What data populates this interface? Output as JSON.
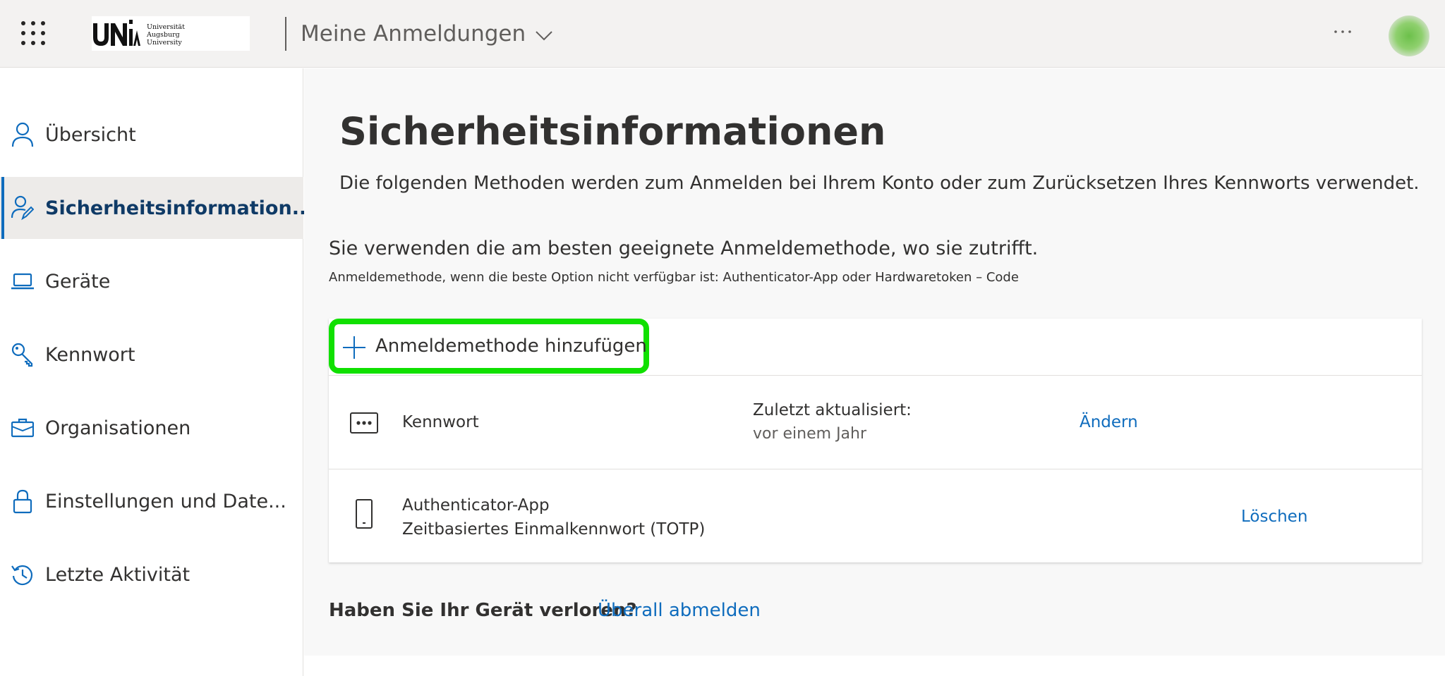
{
  "header": {
    "logo": {
      "mark": "UNiA",
      "lines": [
        "Universität",
        "Augsburg",
        "University"
      ]
    },
    "app_title": "Meine Anmeldungen",
    "more_label": "···"
  },
  "sidebar": {
    "items": [
      {
        "label": "Übersicht",
        "icon": "person-icon"
      },
      {
        "label": "Sicherheitsinformation...",
        "icon": "person-key-icon",
        "active": true
      },
      {
        "label": "Geräte",
        "icon": "laptop-icon"
      },
      {
        "label": "Kennwort",
        "icon": "key-icon"
      },
      {
        "label": "Organisationen",
        "icon": "briefcase-icon"
      },
      {
        "label": "Einstellungen und Date...",
        "icon": "lock-icon"
      },
      {
        "label": "Letzte Aktivität",
        "icon": "history-icon"
      }
    ]
  },
  "main": {
    "title": "Sicherheitsinformationen",
    "description": "Die folgenden Methoden werden zum Anmelden bei Ihrem Konto oder zum Zurücksetzen Ihres Kennworts verwendet.",
    "default_heading": "Sie verwenden die am besten geeignete Anmeldemethode, wo sie zutrifft.",
    "default_sub": "Anmeldemethode, wenn die beste Option nicht verfügbar ist: Authenticator-App oder Hardwaretoken – Code",
    "add_method_label": "Anmeldemethode hinzufügen",
    "methods": [
      {
        "name": "Kennwort",
        "icon": "password-dots-icon",
        "updated_label": "Zuletzt aktualisiert:",
        "updated_value": "vor einem Jahr",
        "action": "Ändern"
      },
      {
        "name": "Authenticator-App",
        "detail": "Zeitbasiertes Einmalkennwort (TOTP)",
        "icon": "phone-icon",
        "action": "Löschen"
      }
    ],
    "lost_device_question": "Haben Sie Ihr Gerät verloren?",
    "lost_device_link": "Überall abmelden"
  },
  "colors": {
    "accent": "#0f6cbd",
    "highlight": "#10e000",
    "header_bg": "#f3f2f1",
    "main_bg": "#f8f8f8"
  }
}
